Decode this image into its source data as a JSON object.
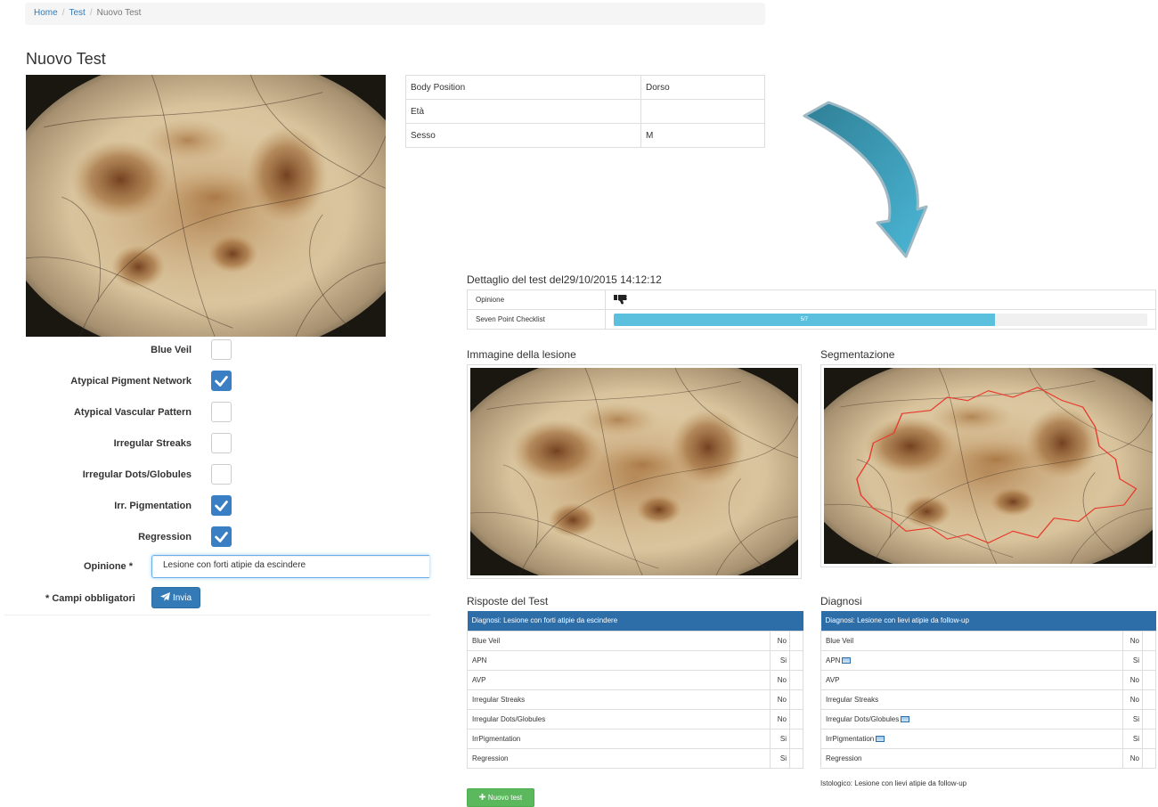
{
  "breadcrumb": {
    "home": "Home",
    "test": "Test",
    "current": "Nuovo Test",
    "separator": "/"
  },
  "page_title": "Nuovo Test",
  "patient_info": [
    {
      "label": "Body Position",
      "value": "Dorso"
    },
    {
      "label": "Età",
      "value": ""
    },
    {
      "label": "Sesso",
      "value": "M"
    }
  ],
  "checklist": [
    {
      "label": "Blue Veil",
      "checked": false
    },
    {
      "label": "Atypical Pigment Network",
      "checked": true
    },
    {
      "label": "Atypical Vascular Pattern",
      "checked": false
    },
    {
      "label": "Irregular Streaks",
      "checked": false
    },
    {
      "label": "Irregular Dots/Globules",
      "checked": false
    },
    {
      "label": "Irr. Pigmentation",
      "checked": true
    },
    {
      "label": "Regression",
      "checked": true
    }
  ],
  "opinion": {
    "label": "Opinione *",
    "value": "Lesione con forti atipie da escindere"
  },
  "required_note": "* Campi obbligatori",
  "submit_label": "Invia",
  "detail": {
    "title": "Dettaglio del test del29/10/2015 14:12:12",
    "opinion_label": "Opinione",
    "checklist_label": "Seven Point Checklist",
    "checklist_score": "5/7",
    "checklist_fraction": 0.714
  },
  "lesion_image_title": "Immagine della lesione",
  "segmentation_title": "Segmentazione",
  "answers": {
    "title": "Risposte del Test",
    "header": "Diagnosi: Lesione con forti atipie da escindere",
    "rows": [
      {
        "label": "Blue Veil",
        "value": "No"
      },
      {
        "label": "APN",
        "value": "Si"
      },
      {
        "label": "AVP",
        "value": "No"
      },
      {
        "label": "Irregular Streaks",
        "value": "No"
      },
      {
        "label": "Irregular Dots/Globules",
        "value": "No"
      },
      {
        "label": "IrrPigmentation",
        "value": "Si"
      },
      {
        "label": "Regression",
        "value": "Si"
      }
    ]
  },
  "diagnosis": {
    "title": "Diagnosi",
    "header": "Diagnosi: Lesione con lievi atipie da follow-up",
    "rows": [
      {
        "label": "Blue Veil",
        "value": "No",
        "image_icon": false
      },
      {
        "label": "APN",
        "value": "Si",
        "image_icon": true
      },
      {
        "label": "AVP",
        "value": "No",
        "image_icon": false
      },
      {
        "label": "Irregular Streaks",
        "value": "No",
        "image_icon": false
      },
      {
        "label": "Irregular Dots/Globules",
        "value": "Si",
        "image_icon": true
      },
      {
        "label": "IrrPigmentation",
        "value": "Si",
        "image_icon": true
      },
      {
        "label": "Regression",
        "value": "No",
        "image_icon": false
      }
    ]
  },
  "istologico": "Istologico: Lesione con lievi atipie da follow-up",
  "new_test_label": "Nuovo test",
  "icons": {
    "thumbs_down": "thumbs-down-icon",
    "send": "paper-plane-icon",
    "plus": "plus-icon",
    "check": "check-icon",
    "picture": "picture-icon",
    "arrow": "curved-arrow-icon"
  },
  "colors": {
    "primary": "#337ab7",
    "checkbox_on": "#3a7ec4",
    "table_header": "#2d6da8",
    "progress": "#5bc0de",
    "success": "#5cb85c",
    "arrow": "#3c9dbd",
    "segmentation_outline": "#e8392c"
  }
}
